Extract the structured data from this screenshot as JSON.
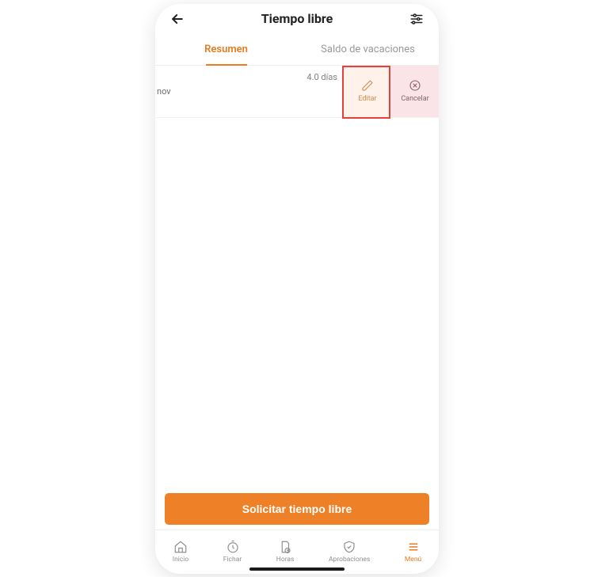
{
  "header": {
    "title": "Tiempo libre"
  },
  "tabs": {
    "summary": "Resumen",
    "balance": "Saldo de vacaciones"
  },
  "row": {
    "month": "nov",
    "days": "4.0 días",
    "editLabel": "Editar",
    "cancelLabel": "Cancelar"
  },
  "cta": {
    "label": "Solicitar tiempo libre"
  },
  "nav": {
    "home": "Inicio",
    "clock": "Fichar",
    "hours": "Horas",
    "approvals": "Aprobaciones",
    "menu": "Menú"
  }
}
